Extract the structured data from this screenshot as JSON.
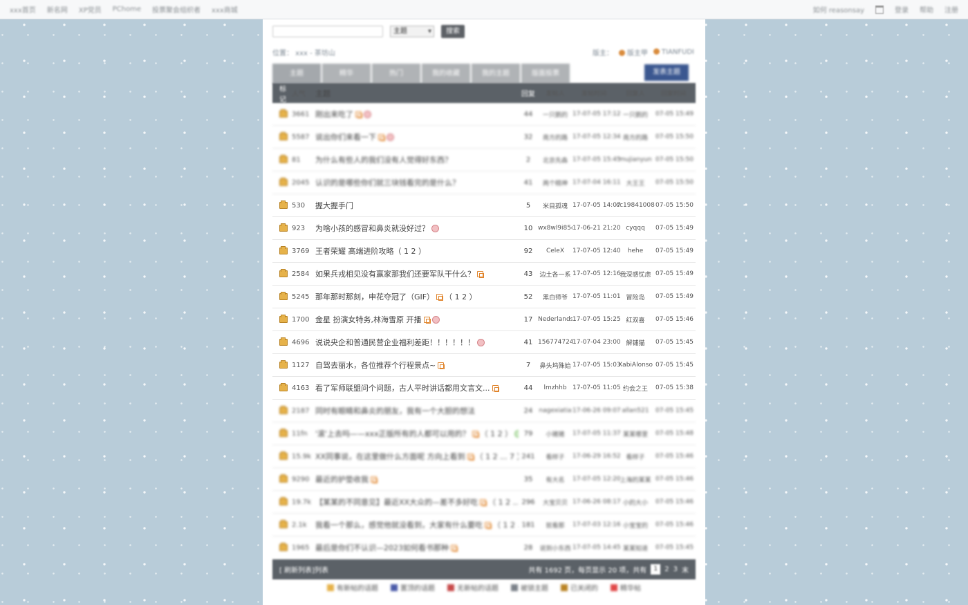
{
  "top_nav": {
    "left": [
      "xxx首页",
      "新名网",
      "XP党员",
      "PChome",
      "投票聚会组织者",
      "xxx商城"
    ],
    "right": [
      "如何 reasonsay",
      "登录",
      "帮助",
      "注册"
    ]
  },
  "search": {
    "placeholder": "",
    "select_value": "主题",
    "button": "搜索"
  },
  "breadcrumb": "位置： xxx - 茶坊山",
  "moderators": {
    "label": "版主：",
    "names": [
      "版主甲",
      "TIANFUDI"
    ]
  },
  "tabs": [
    "主题",
    "精华",
    "热门",
    "我的收藏",
    "我的主题",
    "版面投票"
  ],
  "post_button": "发表主题",
  "columns": [
    "标记",
    "人气",
    "主题",
    "回复",
    "发帖人",
    "发帖时间",
    "回复人",
    "回复时间"
  ],
  "rows": [
    {
      "id": "3661",
      "title": "刚出来吃了",
      "reply": "44",
      "author": "一只鹅的",
      "time": "17-07-05 17:12",
      "last": "一只鹅的",
      "lt": "07-05 15:49",
      "img": true,
      "face": true
    },
    {
      "id": "5587",
      "title": "说出你们来看一下",
      "reply": "32",
      "author": "南方的路",
      "time": "17-07-05 12:34",
      "last": "南方的路",
      "lt": "07-05 15:50",
      "img": true,
      "face": true
    },
    {
      "id": "81",
      "title": "为什么有些人的我们没有人觉得好东西？",
      "reply": "2",
      "author": "北京先森",
      "time": "17-07-05 15:45",
      "last": "mujianyun",
      "lt": "07-05 15:50",
      "img": false,
      "face": false
    },
    {
      "id": "2045",
      "title": "认识的是哪些你们就三块钱看完的是什么？",
      "reply": "41",
      "author": "两个精神",
      "time": "17-07-04 16:11",
      "last": "大王王",
      "lt": "07-05 15:50",
      "img": false,
      "face": false
    },
    {
      "id": "530",
      "title": "握大握手门",
      "reply": "5",
      "author": "米目孤魂",
      "time": "17-07-05 14:07",
      "last": "cc19841008",
      "lt": "07-05 15:50",
      "img": false,
      "face": false
    },
    {
      "id": "923",
      "title": "为啥小孩的感冒和鼻炎就没好过？",
      "reply": "10",
      "author": "wx8wl9i85c",
      "time": "17-06-21 21:20",
      "last": "cyqqq",
      "lt": "07-05 15:49",
      "img": false,
      "face": true
    },
    {
      "id": "3769",
      "title": "王者荣耀 高端进阶攻略（ 1 2 ）",
      "reply": "92",
      "author": "CeleX",
      "time": "17-07-05 12:40",
      "last": "hehe",
      "lt": "07-05 15:49",
      "img": false,
      "face": false
    },
    {
      "id": "2584",
      "title": "如果兵戎相见没有赢家那我们还要军队干什么？",
      "reply": "43",
      "author": "边土各一系",
      "time": "17-07-05 12:16",
      "last": "我深感忧虑",
      "lt": "07-05 15:49",
      "img": true,
      "face": false
    },
    {
      "id": "5245",
      "title": "那年那时那刻，申花夺冠了（GIF）",
      "suffix": "（ 1 2 ）",
      "reply": "52",
      "author": "黑白师爷",
      "time": "17-07-05 11:01",
      "last": "冒险岛",
      "lt": "07-05 15:49",
      "img": true,
      "face": false
    },
    {
      "id": "1700",
      "title": "金星 扮演女特务,林海雪原 开播",
      "reply": "17",
      "author": "Nederlands",
      "time": "17-07-05 15:25",
      "last": "红双喜",
      "lt": "07-05 15:46",
      "img": true,
      "face": true
    },
    {
      "id": "4696",
      "title": "说说央企和普通民营企业福利差距！！！！！！",
      "reply": "41",
      "author": "156774724",
      "time": "17-07-04 23:00",
      "last": "解铺猫",
      "lt": "07-05 15:45",
      "img": false,
      "face": true
    },
    {
      "id": "1127",
      "title": "自驾去丽水，各位推荐个行程景点~",
      "reply": "7",
      "author": "鼻头坞殊始",
      "time": "17-07-05 15:03",
      "last": "XabiAlonso",
      "lt": "07-05 15:45",
      "img": true,
      "face": false
    },
    {
      "id": "4163",
      "title": "看了军师联盟问个问题，古人平时讲话都用文言文...",
      "reply": "44",
      "author": "lmzhhb",
      "time": "17-07-05 11:05",
      "last": "约会之王",
      "lt": "07-05 15:38",
      "img": true,
      "face": false
    },
    {
      "id": "2187",
      "title": "同时有眼睛和鼻炎的朋友，我有一个大胆的想法",
      "reply": "24",
      "author": "nagexiatia",
      "time": "17-06-26 09:07",
      "last": "allan521",
      "lt": "07-05 15:45",
      "img": false,
      "face": false
    },
    {
      "id": "11fn",
      "title": "'滚'上去吗——xxx正版所有的人都可以用的？",
      "suffix": "（ 1 2 ）",
      "reply": "79",
      "author": "小猪猪",
      "time": "17-07-05 11:37",
      "last": "某某哪里",
      "lt": "07-05 15:48",
      "img": true,
      "face": true,
      "green": true
    },
    {
      "id": "15.9k",
      "title": "XX同事说，在这里做什么方面呢 方向上看到",
      "suffix": "（ 1 2 ... 7 ）",
      "reply": "241",
      "author": "看样子",
      "time": "17-06-29 16:52",
      "last": "看样子",
      "lt": "07-05 15:46",
      "img": true,
      "face": true
    },
    {
      "id": "9290",
      "title": "最近的护垫收我",
      "reply": "35",
      "author": "有大名",
      "time": "17-07-05 12:20",
      "last": "上海的某某",
      "lt": "07-05 15:46",
      "img": true,
      "face": false
    },
    {
      "id": "19.7k",
      "title": "【某某的不同意见】最近XX大众的—差不多好吃",
      "suffix": "（ 1 2 ... 7 ）",
      "reply": "296",
      "author": "大宝贝贝",
      "time": "17-06-26 08:17",
      "last": "小的大小",
      "lt": "07-05 15:46",
      "img": true,
      "face": true
    },
    {
      "id": "2.1k",
      "title": "我看一个那么，感觉他就没看到，大家有什么要吃",
      "suffix": "（ 1 2 ... 4 ）",
      "reply": "181",
      "author": "就看那",
      "time": "17-07-03 12:16",
      "last": "小宝宝的",
      "lt": "07-05 15:46",
      "img": true,
      "face": false
    },
    {
      "id": "1965",
      "title": "最后是你们不认识—2023如何看书那种",
      "reply": "28",
      "author": "说到小东西",
      "time": "17-07-05 14:45",
      "last": "某某知道",
      "lt": "07-05 15:45",
      "img": true,
      "face": false
    }
  ],
  "footer": {
    "left": "[ 刷新列表]列表",
    "pages_text": "共有 1692 页，每页显示 20 项，共有",
    "current_page": "1",
    "pages": [
      "2",
      "3",
      "末"
    ]
  },
  "legend": [
    "有新帖的话题",
    "置顶的话题",
    "无新帖的话题",
    "被锁主题",
    "已关闭的",
    "精华帖"
  ],
  "colors": {
    "header_bg": "#5b6167",
    "accent_button": "#3b5790",
    "page_bg": "#b8ccd9"
  }
}
